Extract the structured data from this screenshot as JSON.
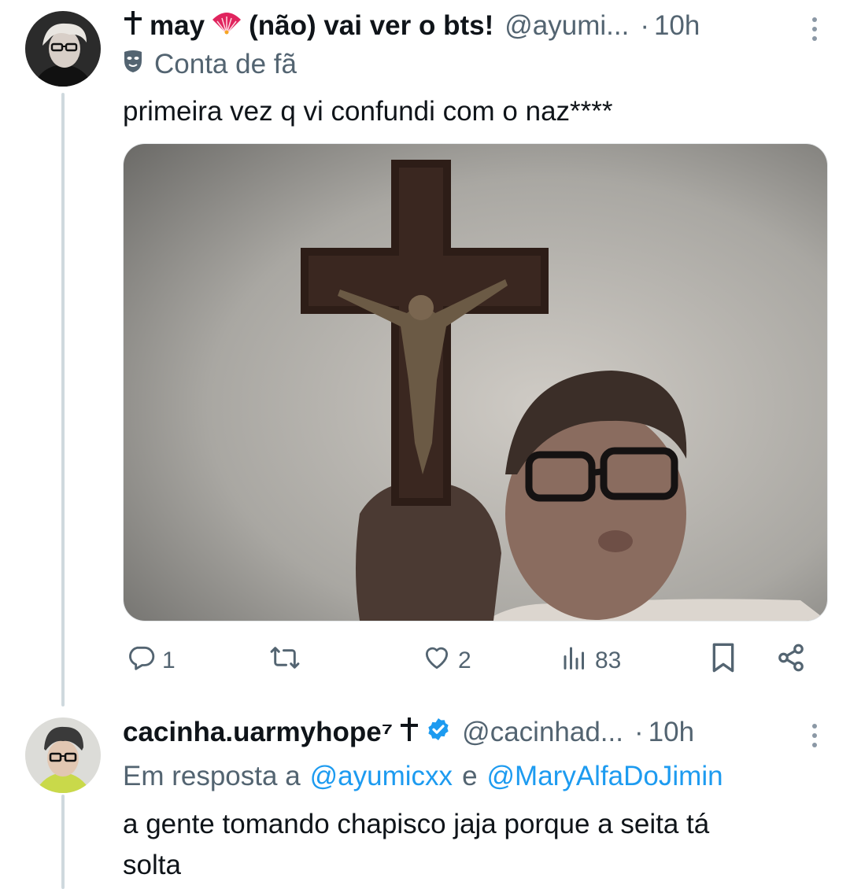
{
  "tweets": [
    {
      "display_name": "may",
      "handle": "@ayumi...",
      "separator": "·",
      "time": "10h",
      "name_middle": "(não) vai ver o bts!",
      "label": "Conta de fã",
      "text": "primeira vez q vi confundi com o naz****",
      "stats": {
        "replies": "1",
        "likes": "2",
        "views": "83"
      }
    },
    {
      "display_name": "cacinha.uarmyhope⁷",
      "handle": "@cacinhad...",
      "separator": "·",
      "time": "10h",
      "reply_prefix": "Em resposta a",
      "mention_1": "@ayumicxx",
      "conjunction": "e",
      "mention_2": "@MaryAlfaDoJimin",
      "text_line1": "a gente tomando chapisco jaja porque a seita tá",
      "text_line2": "solta"
    }
  ],
  "colors": {
    "accent": "#1d9bf0",
    "secondary_text": "#536471",
    "thread_line": "#cfd9de",
    "fan_emoji": "#e0245e"
  },
  "icons": [
    "cross-icon",
    "fan-icon",
    "mask-icon",
    "reply-icon",
    "retweet-icon",
    "like-icon",
    "views-icon",
    "bookmark-icon",
    "share-icon",
    "verified-icon",
    "more-icon"
  ]
}
